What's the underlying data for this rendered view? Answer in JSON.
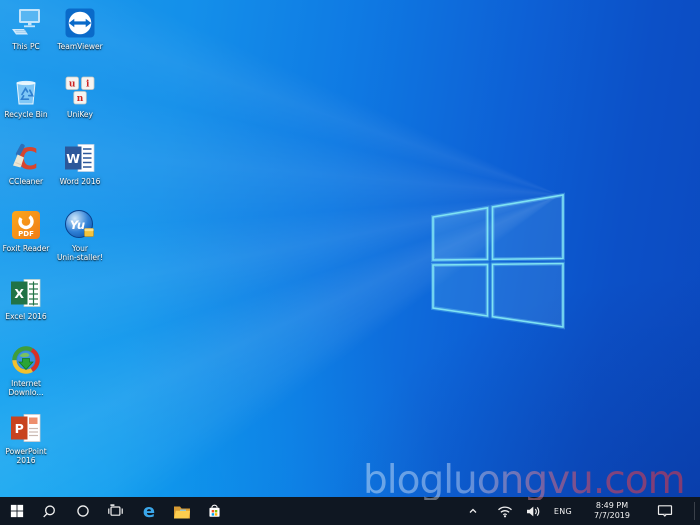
{
  "wallpaper": {
    "description": "Windows 10 default light-beam blue wallpaper",
    "colors": {
      "left": "#1b9aec",
      "right": "#0b49bf",
      "logo_stroke": "#7fe3f3"
    }
  },
  "watermark": {
    "text": "blogluongvu.com"
  },
  "desktop": {
    "icons": [
      {
        "id": "this-pc",
        "label": "This PC"
      },
      {
        "id": "teamviewer",
        "label": "TeamViewer"
      },
      {
        "id": "recycle-bin",
        "label": "Recycle Bin"
      },
      {
        "id": "unikey",
        "label": "UniKey",
        "keys": [
          "u",
          "i",
          "n"
        ]
      },
      {
        "id": "ccleaner",
        "label": "CCleaner",
        "glyph": "C"
      },
      {
        "id": "word-2016",
        "label": "Word 2016",
        "glyph": "W"
      },
      {
        "id": "foxit-reader",
        "label": "Foxit Reader",
        "glyph": "PDF"
      },
      {
        "id": "your-uninstaller",
        "label": "Your",
        "label2": "Unin-staller!",
        "glyph": "Yu"
      },
      {
        "id": "excel-2016",
        "label": "Excel 2016",
        "glyph": "X"
      },
      {
        "id": "internet-download-manager",
        "label": "Internet",
        "label2": "Downlo..."
      },
      {
        "id": "powerpoint-2016",
        "label": "PowerPoint",
        "label2": "2016",
        "glyph": "P"
      }
    ]
  },
  "taskbar": {
    "buttons": [
      {
        "id": "start",
        "icon": "windows-logo-icon"
      },
      {
        "id": "search",
        "icon": "search-icon"
      },
      {
        "id": "cortana",
        "icon": "cortana-circle-icon"
      },
      {
        "id": "task-view",
        "icon": "task-view-icon"
      },
      {
        "id": "edge",
        "icon": "edge-icon",
        "glyph": "e"
      },
      {
        "id": "file-explorer",
        "icon": "folder-icon"
      },
      {
        "id": "store",
        "icon": "store-bag-icon"
      }
    ],
    "tray": {
      "hidden_icons": "chevron-up-icon",
      "network": "wifi-icon",
      "volume": "speaker-icon",
      "language": "ENG",
      "clock": {
        "time": "8:49 PM",
        "date": "7/7/2019"
      },
      "action_center": "action-center-icon"
    }
  }
}
